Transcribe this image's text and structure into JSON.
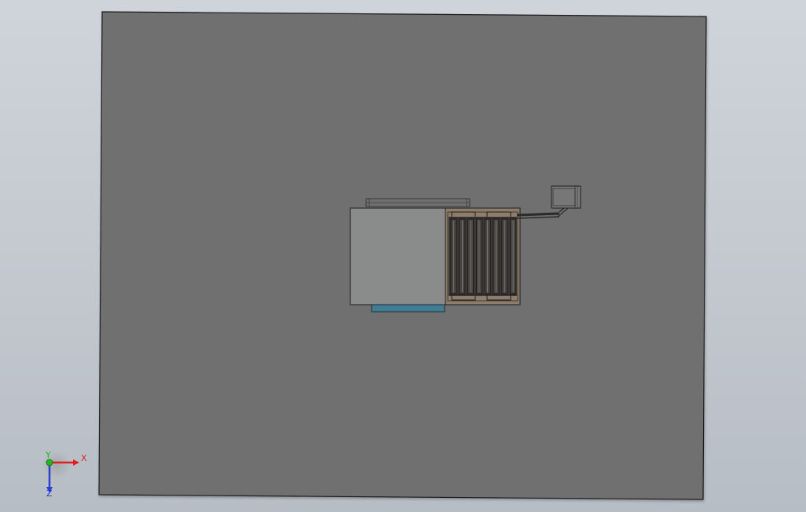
{
  "viewport": {
    "background_top": "#cfd4da",
    "background_bottom": "#b7bdc5"
  },
  "model": {
    "plate_color": "#6f6f6f",
    "block_color": "#8a8b8b",
    "rack_color": "#8e7d6b",
    "base_strip_color": "#3f7c95",
    "line_color": "#1e1e1e"
  },
  "triad": {
    "x_label": "X",
    "y_label": "Y",
    "z_label": "Z",
    "x_color": "#e02020",
    "y_color": "#1fb81f",
    "z_color": "#2a3fcf"
  }
}
